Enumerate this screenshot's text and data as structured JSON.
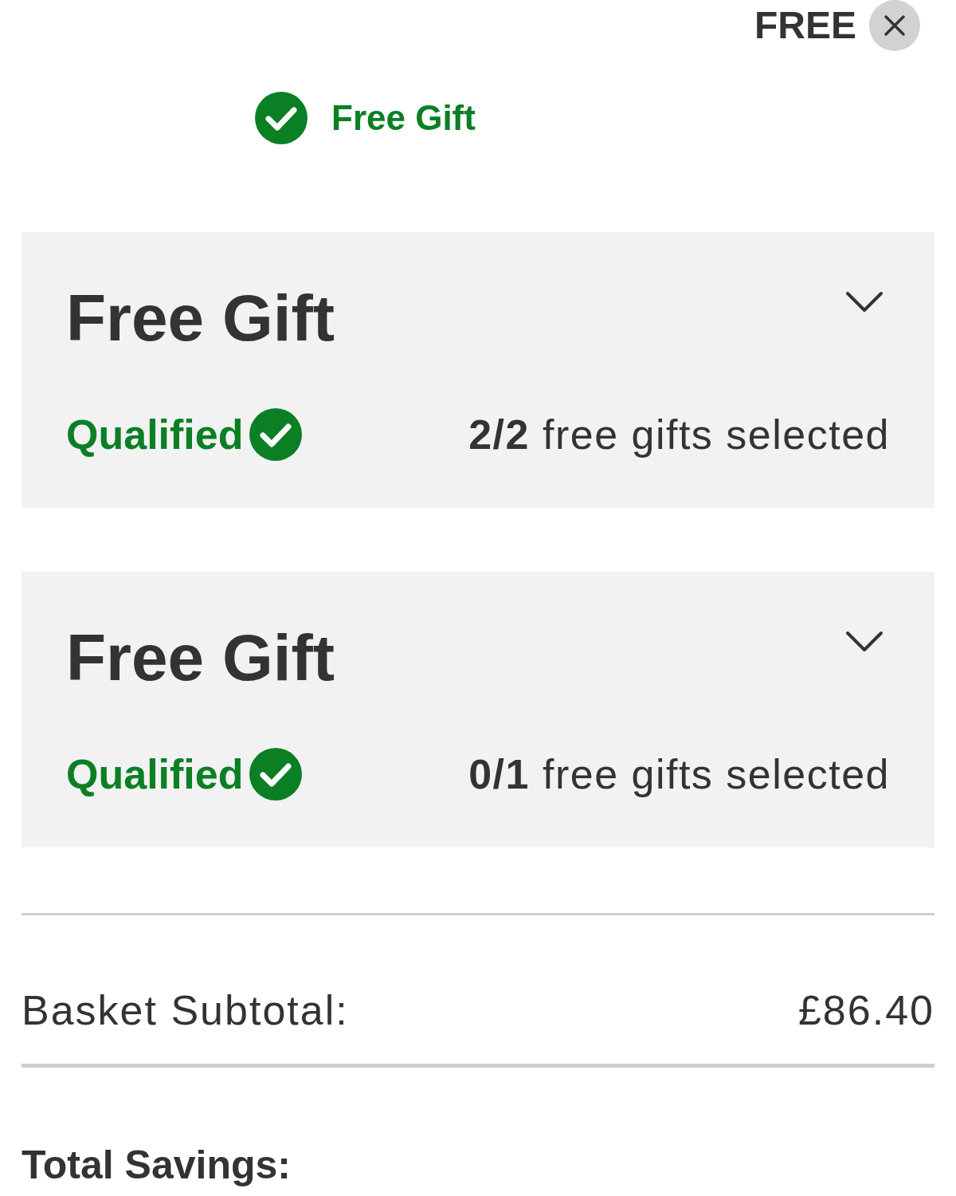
{
  "header": {
    "label": "FREE"
  },
  "promo": {
    "label": "Free Gift",
    "qualified": true
  },
  "gift_panels": [
    {
      "title": "Free Gift",
      "expanded": false,
      "status": "Qualified",
      "qualified": true,
      "selection": "**2/2** free gifts selected"
    },
    {
      "title": "Free Gift",
      "expanded": false,
      "status": "Qualified",
      "qualified": true,
      "selection": "**0/1** free gifts selected"
    }
  ],
  "subtotal": {
    "label": "Basket Subtotal:",
    "value": "£86.40"
  },
  "savings": {
    "label": "Total Savings:"
  }
}
